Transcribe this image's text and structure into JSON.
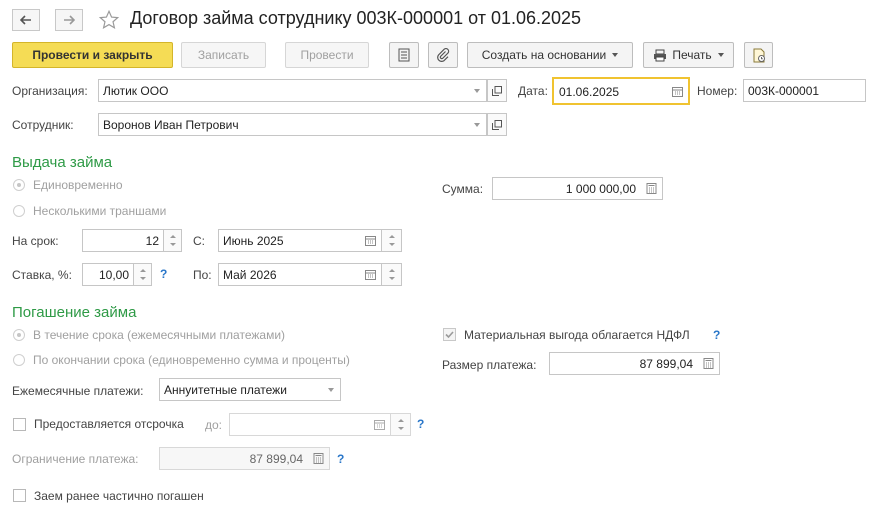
{
  "header": {
    "title": "Договор займа сотруднику 003К-000001 от 01.06.2025",
    "back_icon": "arrow-left",
    "forward_icon": "arrow-right",
    "star_icon": "star"
  },
  "toolbar": {
    "post_close": "Провести и закрыть",
    "save": "Записать",
    "post": "Провести",
    "create_based": "Создать на основании",
    "print": "Печать"
  },
  "org": {
    "label": "Организация:",
    "value": "Лютик ООО"
  },
  "date": {
    "label": "Дата:",
    "value": "01.06.2025"
  },
  "number": {
    "label": "Номер:",
    "value": "003К-000001"
  },
  "employee": {
    "label": "Сотрудник:",
    "value": "Воронов Иван Петрович"
  },
  "issue": {
    "heading": "Выдача займа",
    "once": "Единовременно",
    "tranches": "Несколькими траншами",
    "sum_label": "Сумма:",
    "sum_value": "1 000 000,00",
    "term_label": "На срок:",
    "term_value": "12",
    "from_label": "С:",
    "from_value": "Июнь 2025",
    "rate_label": "Ставка, %:",
    "rate_value": "10,00",
    "to_label": "По:",
    "to_value": "Май 2026",
    "help": "?"
  },
  "repay": {
    "heading": "Погашение займа",
    "during_term": "В течение срока (ежемесячными платежами)",
    "at_end": "По окончании срока (единовременно сумма и проценты)",
    "ndfl": "Материальная выгода облагается НДФЛ",
    "payment_label": "Размер платежа:",
    "payment_value": "87 899,04",
    "monthly_label": "Ежемесячные платежи:",
    "monthly_value": "Аннуитетные платежи",
    "deferral": "Предоставляется отсрочка",
    "until_label": "до:",
    "limit_label": "Ограничение платежа:",
    "limit_value": "87 899,04",
    "partial": "Заем ранее частично погашен",
    "help": "?"
  }
}
